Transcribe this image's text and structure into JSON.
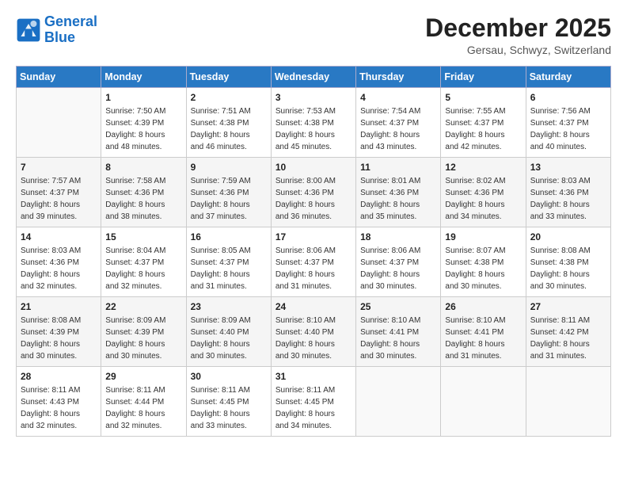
{
  "logo": {
    "line1": "General",
    "line2": "Blue"
  },
  "title": "December 2025",
  "subtitle": "Gersau, Schwyz, Switzerland",
  "days_header": [
    "Sunday",
    "Monday",
    "Tuesday",
    "Wednesday",
    "Thursday",
    "Friday",
    "Saturday"
  ],
  "weeks": [
    [
      {
        "day": "",
        "info": ""
      },
      {
        "day": "1",
        "info": "Sunrise: 7:50 AM\nSunset: 4:39 PM\nDaylight: 8 hours\nand 48 minutes."
      },
      {
        "day": "2",
        "info": "Sunrise: 7:51 AM\nSunset: 4:38 PM\nDaylight: 8 hours\nand 46 minutes."
      },
      {
        "day": "3",
        "info": "Sunrise: 7:53 AM\nSunset: 4:38 PM\nDaylight: 8 hours\nand 45 minutes."
      },
      {
        "day": "4",
        "info": "Sunrise: 7:54 AM\nSunset: 4:37 PM\nDaylight: 8 hours\nand 43 minutes."
      },
      {
        "day": "5",
        "info": "Sunrise: 7:55 AM\nSunset: 4:37 PM\nDaylight: 8 hours\nand 42 minutes."
      },
      {
        "day": "6",
        "info": "Sunrise: 7:56 AM\nSunset: 4:37 PM\nDaylight: 8 hours\nand 40 minutes."
      }
    ],
    [
      {
        "day": "7",
        "info": "Sunrise: 7:57 AM\nSunset: 4:37 PM\nDaylight: 8 hours\nand 39 minutes."
      },
      {
        "day": "8",
        "info": "Sunrise: 7:58 AM\nSunset: 4:36 PM\nDaylight: 8 hours\nand 38 minutes."
      },
      {
        "day": "9",
        "info": "Sunrise: 7:59 AM\nSunset: 4:36 PM\nDaylight: 8 hours\nand 37 minutes."
      },
      {
        "day": "10",
        "info": "Sunrise: 8:00 AM\nSunset: 4:36 PM\nDaylight: 8 hours\nand 36 minutes."
      },
      {
        "day": "11",
        "info": "Sunrise: 8:01 AM\nSunset: 4:36 PM\nDaylight: 8 hours\nand 35 minutes."
      },
      {
        "day": "12",
        "info": "Sunrise: 8:02 AM\nSunset: 4:36 PM\nDaylight: 8 hours\nand 34 minutes."
      },
      {
        "day": "13",
        "info": "Sunrise: 8:03 AM\nSunset: 4:36 PM\nDaylight: 8 hours\nand 33 minutes."
      }
    ],
    [
      {
        "day": "14",
        "info": "Sunrise: 8:03 AM\nSunset: 4:36 PM\nDaylight: 8 hours\nand 32 minutes."
      },
      {
        "day": "15",
        "info": "Sunrise: 8:04 AM\nSunset: 4:37 PM\nDaylight: 8 hours\nand 32 minutes."
      },
      {
        "day": "16",
        "info": "Sunrise: 8:05 AM\nSunset: 4:37 PM\nDaylight: 8 hours\nand 31 minutes."
      },
      {
        "day": "17",
        "info": "Sunrise: 8:06 AM\nSunset: 4:37 PM\nDaylight: 8 hours\nand 31 minutes."
      },
      {
        "day": "18",
        "info": "Sunrise: 8:06 AM\nSunset: 4:37 PM\nDaylight: 8 hours\nand 30 minutes."
      },
      {
        "day": "19",
        "info": "Sunrise: 8:07 AM\nSunset: 4:38 PM\nDaylight: 8 hours\nand 30 minutes."
      },
      {
        "day": "20",
        "info": "Sunrise: 8:08 AM\nSunset: 4:38 PM\nDaylight: 8 hours\nand 30 minutes."
      }
    ],
    [
      {
        "day": "21",
        "info": "Sunrise: 8:08 AM\nSunset: 4:39 PM\nDaylight: 8 hours\nand 30 minutes."
      },
      {
        "day": "22",
        "info": "Sunrise: 8:09 AM\nSunset: 4:39 PM\nDaylight: 8 hours\nand 30 minutes."
      },
      {
        "day": "23",
        "info": "Sunrise: 8:09 AM\nSunset: 4:40 PM\nDaylight: 8 hours\nand 30 minutes."
      },
      {
        "day": "24",
        "info": "Sunrise: 8:10 AM\nSunset: 4:40 PM\nDaylight: 8 hours\nand 30 minutes."
      },
      {
        "day": "25",
        "info": "Sunrise: 8:10 AM\nSunset: 4:41 PM\nDaylight: 8 hours\nand 30 minutes."
      },
      {
        "day": "26",
        "info": "Sunrise: 8:10 AM\nSunset: 4:41 PM\nDaylight: 8 hours\nand 31 minutes."
      },
      {
        "day": "27",
        "info": "Sunrise: 8:11 AM\nSunset: 4:42 PM\nDaylight: 8 hours\nand 31 minutes."
      }
    ],
    [
      {
        "day": "28",
        "info": "Sunrise: 8:11 AM\nSunset: 4:43 PM\nDaylight: 8 hours\nand 32 minutes."
      },
      {
        "day": "29",
        "info": "Sunrise: 8:11 AM\nSunset: 4:44 PM\nDaylight: 8 hours\nand 32 minutes."
      },
      {
        "day": "30",
        "info": "Sunrise: 8:11 AM\nSunset: 4:45 PM\nDaylight: 8 hours\nand 33 minutes."
      },
      {
        "day": "31",
        "info": "Sunrise: 8:11 AM\nSunset: 4:45 PM\nDaylight: 8 hours\nand 34 minutes."
      },
      {
        "day": "",
        "info": ""
      },
      {
        "day": "",
        "info": ""
      },
      {
        "day": "",
        "info": ""
      }
    ]
  ]
}
